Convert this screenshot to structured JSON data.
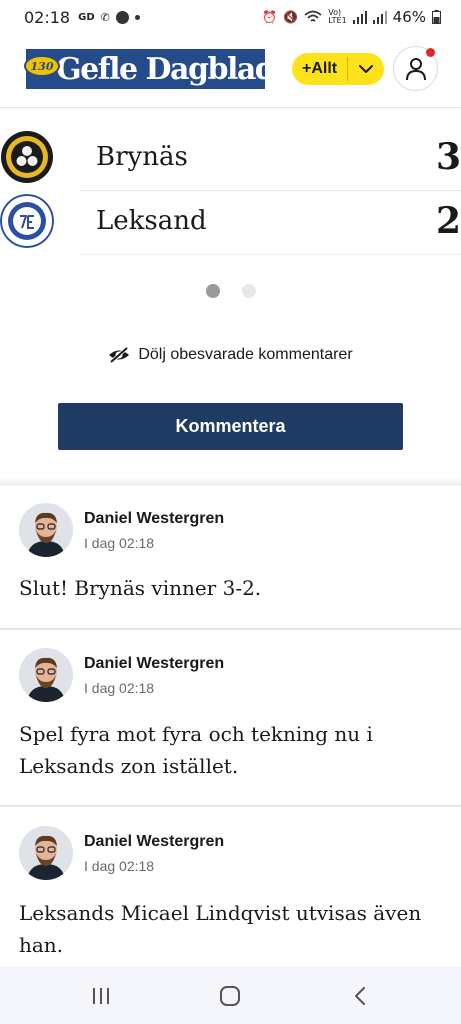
{
  "status_bar": {
    "time": "02:18",
    "left_icons": [
      "gd-icon",
      "missed-call-icon",
      "messenger-icon",
      "dot"
    ],
    "battery": "46%"
  },
  "header": {
    "logo_text": "Gefle Dagblad",
    "anniversary": "130",
    "allt_label": "+Allt"
  },
  "scoreboard": {
    "teams": [
      {
        "name": "Brynäs",
        "score": "3",
        "logo": "brynas-logo"
      },
      {
        "name": "Leksand",
        "score": "2",
        "logo": "leksand-logo"
      }
    ],
    "pages": 2,
    "active_page": 0
  },
  "controls": {
    "hide_unanswered": "Dölj obesvarade kommentarer",
    "comment_button": "Kommentera"
  },
  "comments": [
    {
      "author": "Daniel Westergren",
      "time": "I dag 02:18",
      "text": "Slut! Brynäs vinner 3-2."
    },
    {
      "author": "Daniel Westergren",
      "time": "I dag 02:18",
      "text": "Spel fyra mot fyra och tekning nu i Leksands zon istället."
    },
    {
      "author": "Daniel Westergren",
      "time": "I dag 02:18",
      "text": "Leksands Micael Lindqvist utvisas även han."
    }
  ],
  "colors": {
    "brand_blue": "#254b8a",
    "button_navy": "#1f3a63",
    "allt_yellow": "#ffe21a"
  }
}
